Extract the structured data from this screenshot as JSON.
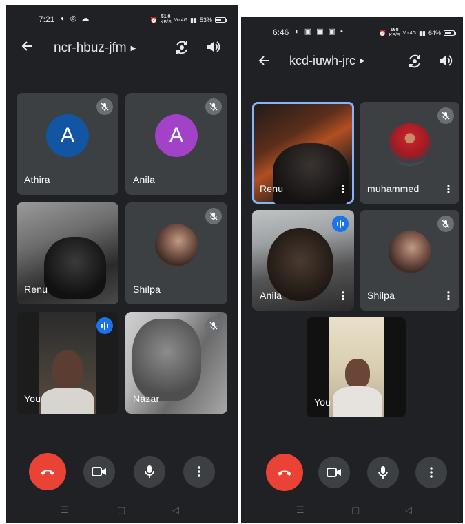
{
  "phone1": {
    "status": {
      "time": "7:21",
      "left_icons": "◐ ◎ ☁",
      "data_rate_top": "51.0",
      "data_rate_bottom": "KB/S",
      "network": "Vo 4G",
      "battery": "53%",
      "battery_level": 0.53
    },
    "header": {
      "title": "ncr-hbuz-jfm"
    },
    "tiles": [
      {
        "name": "Athira",
        "initial": "A",
        "avatar_color": "#1155a3",
        "muted": true
      },
      {
        "name": "Anila",
        "initial": "A",
        "avatar_color": "#a142c8",
        "muted": true
      },
      {
        "name": "Renu",
        "muted": false
      },
      {
        "name": "Shilpa",
        "muted": true
      },
      {
        "name": "You",
        "speaking": true
      },
      {
        "name": "Nazar",
        "muted": true
      }
    ]
  },
  "phone2": {
    "status": {
      "time": "6:46",
      "left_icons": "◐ ▣ ▣ ▣ •",
      "data_rate_top": "168",
      "data_rate_bottom": "KB/S",
      "network": "Vo 4G",
      "battery": "64%",
      "battery_level": 0.64
    },
    "header": {
      "title": "kcd-iuwh-jrc"
    },
    "tiles": [
      {
        "name": "Renu",
        "selected": true
      },
      {
        "name": "muhammed",
        "muted": true
      },
      {
        "name": "Anila",
        "speaking": true
      },
      {
        "name": "Shilpa",
        "muted": true
      },
      {
        "name": "You"
      }
    ]
  },
  "colors": {
    "background": "#202124",
    "tile": "#3c4043",
    "end_call": "#ea4335",
    "accent": "#1a73e8"
  },
  "icons": [
    "back-arrow-icon",
    "caret-right-icon",
    "camera-flip-icon",
    "speaker-icon",
    "mic-off-icon",
    "speaking-indicator-icon",
    "more-vert-icon",
    "end-call-icon",
    "video-camera-icon",
    "mic-icon",
    "nav-menu-icon",
    "nav-home-icon",
    "nav-back-icon"
  ]
}
